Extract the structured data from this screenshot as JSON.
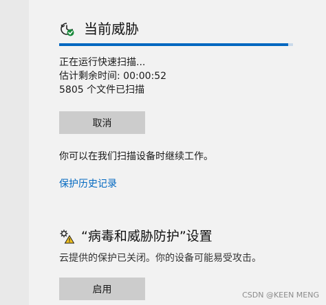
{
  "current_threats": {
    "title": "当前威胁",
    "icon": "clock-check-icon",
    "scan_progress_fraction": 0.98,
    "status_lines": [
      "正在运行快速扫描...",
      "估计剩余时间: 00:00:52",
      "5805 个文件已扫描"
    ],
    "cancel_label": "取消",
    "hint": "你可以在我们扫描设备时继续工作。",
    "history_link": "保护历史记录"
  },
  "settings_section": {
    "title": "“病毒和威胁防护”设置",
    "icon": "gear-warning-icon",
    "description": "云提供的保护已关闭。你的设备可能易受攻击。",
    "enable_label": "启用"
  },
  "watermark": "CSDN @KEEN MENG",
  "colors": {
    "accent": "#0067c0",
    "progress_track": "#c9d9ea",
    "button_bg": "#cccccc",
    "warning": "#f0c020",
    "ok_green": "#1a8a3c"
  }
}
